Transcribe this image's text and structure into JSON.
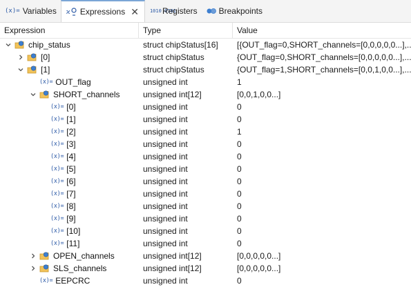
{
  "tabs": [
    {
      "icon": "(x)=",
      "label": "Variables",
      "active": false
    },
    {
      "icon": "expressions-icon",
      "label": "Expressions",
      "active": true,
      "closable": true
    },
    {
      "icon": "1010 0101",
      "label": "Registers",
      "active": false
    },
    {
      "icon": "breakpoints-icon",
      "label": "Breakpoints",
      "active": false
    }
  ],
  "close_glyph": "✕",
  "columns": {
    "expression": "Expression",
    "type": "Type",
    "value": "Value"
  },
  "rows": [
    {
      "indent": 0,
      "twisty": "expanded",
      "icon": "struct",
      "name": "chip_status",
      "type": "struct chipStatus[16]",
      "value": "[{OUT_flag=0,SHORT_channels=[0,0,0,0,0...],..."
    },
    {
      "indent": 1,
      "twisty": "collapsed",
      "icon": "struct",
      "name": "[0]",
      "type": "struct chipStatus",
      "value": "{OUT_flag=0,SHORT_channels=[0,0,0,0,0...],..."
    },
    {
      "indent": 1,
      "twisty": "expanded",
      "icon": "struct",
      "name": "[1]",
      "type": "struct chipStatus",
      "value": "{OUT_flag=1,SHORT_channels=[0,0,1,0,0...],..."
    },
    {
      "indent": 2,
      "twisty": "none",
      "icon": "var",
      "name": "OUT_flag",
      "type": "unsigned int",
      "value": "1"
    },
    {
      "indent": 2,
      "twisty": "expanded",
      "icon": "struct",
      "name": "SHORT_channels",
      "type": "unsigned int[12]",
      "value": "[0,0,1,0,0...]"
    },
    {
      "indent": 3,
      "twisty": "none",
      "icon": "var",
      "name": "[0]",
      "type": "unsigned int",
      "value": "0"
    },
    {
      "indent": 3,
      "twisty": "none",
      "icon": "var",
      "name": "[1]",
      "type": "unsigned int",
      "value": "0"
    },
    {
      "indent": 3,
      "twisty": "none",
      "icon": "var",
      "name": "[2]",
      "type": "unsigned int",
      "value": "1"
    },
    {
      "indent": 3,
      "twisty": "none",
      "icon": "var",
      "name": "[3]",
      "type": "unsigned int",
      "value": "0"
    },
    {
      "indent": 3,
      "twisty": "none",
      "icon": "var",
      "name": "[4]",
      "type": "unsigned int",
      "value": "0"
    },
    {
      "indent": 3,
      "twisty": "none",
      "icon": "var",
      "name": "[5]",
      "type": "unsigned int",
      "value": "0"
    },
    {
      "indent": 3,
      "twisty": "none",
      "icon": "var",
      "name": "[6]",
      "type": "unsigned int",
      "value": "0"
    },
    {
      "indent": 3,
      "twisty": "none",
      "icon": "var",
      "name": "[7]",
      "type": "unsigned int",
      "value": "0"
    },
    {
      "indent": 3,
      "twisty": "none",
      "icon": "var",
      "name": "[8]",
      "type": "unsigned int",
      "value": "0"
    },
    {
      "indent": 3,
      "twisty": "none",
      "icon": "var",
      "name": "[9]",
      "type": "unsigned int",
      "value": "0"
    },
    {
      "indent": 3,
      "twisty": "none",
      "icon": "var",
      "name": "[10]",
      "type": "unsigned int",
      "value": "0"
    },
    {
      "indent": 3,
      "twisty": "none",
      "icon": "var",
      "name": "[11]",
      "type": "unsigned int",
      "value": "0"
    },
    {
      "indent": 2,
      "twisty": "collapsed",
      "icon": "struct",
      "name": "OPEN_channels",
      "type": "unsigned int[12]",
      "value": "[0,0,0,0,0...]"
    },
    {
      "indent": 2,
      "twisty": "collapsed",
      "icon": "struct",
      "name": "SLS_channels",
      "type": "unsigned int[12]",
      "value": "[0,0,0,0,0...]"
    },
    {
      "indent": 2,
      "twisty": "none",
      "icon": "var",
      "name": "EEPCRC",
      "type": "unsigned int",
      "value": "0"
    }
  ],
  "var_icon_glyph": "(x)=",
  "colors": {
    "accent": "#2b59a6",
    "struct_folder": "#e8b24a",
    "struct_node": "#3d7fd0"
  }
}
